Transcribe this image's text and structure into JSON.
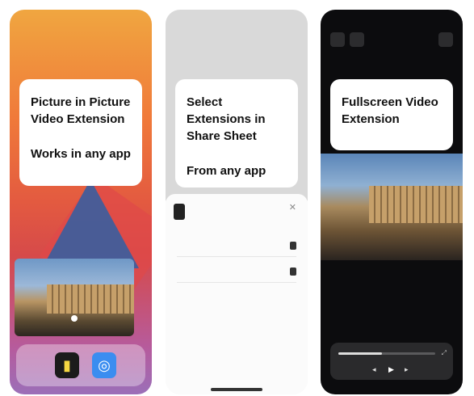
{
  "screens": [
    {
      "status_time": "",
      "status_icons": "",
      "card_headline": "Picture in Picture Video Extension",
      "card_sub": "Works in any app",
      "dock_icons": [
        "video-app-icon",
        "safari-icon"
      ]
    },
    {
      "status_time": "",
      "status_icons": "",
      "card_headline": "Select Extensions in Share Sheet",
      "card_sub": "From any app",
      "share_rows": [
        "",
        ""
      ],
      "edit_label": ""
    },
    {
      "status_time": "",
      "status_icons": "",
      "card_headline": "Fullscreen Video Extension",
      "player": {
        "progress": 0.45
      }
    }
  ],
  "colors": {
    "brand_orange": "#f0a640",
    "accent_blue": "#3b8df0",
    "dark_bg": "#0c0c0e"
  }
}
